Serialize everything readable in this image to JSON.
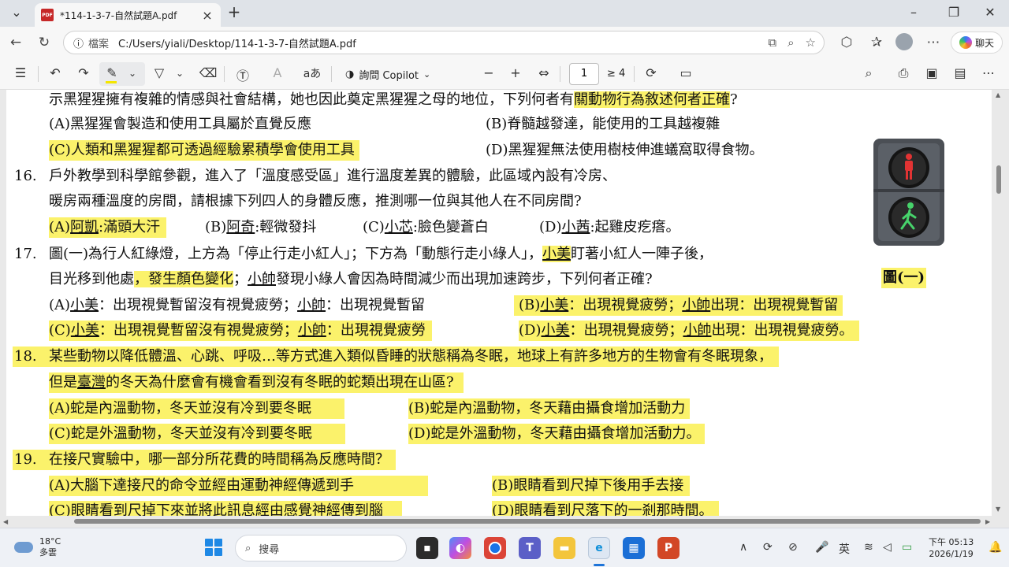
{
  "browser": {
    "tab_title": "*114-1-3-7-自然試題A.pdf",
    "pdf_badge": "PDF",
    "address_label": "檔案",
    "address_url": "C:/Users/yiali/Desktop/114-1-3-7-自然試題A.pdf",
    "copilot_button": "聊天"
  },
  "pdf_toolbar": {
    "ask_copilot": "詢問 Copilot",
    "current_page": "1",
    "total_pages": "≥ 4",
    "read_aloud": "aあ"
  },
  "document": {
    "q15_line1_a": "示黑猩猩擁有複雜的情感與社會結構，她也因此奠定黑猩猩之母的地位，下列何者有",
    "q15_line1_hl": "關動物行為敘述何者正確",
    "q15_line1_end": "?",
    "q15_optA": "(A)黑猩猩會製造和使用工具屬於直覺反應",
    "q15_optB": "(B)脊髓越發達，能使用的工具越複雜",
    "q15_optC": "(C)人類和黑猩猩都可透過經驗累積學會使用工具",
    "q15_optD": "(D)黑猩猩無法使用樹枝伸進蟻窩取得食物。",
    "q16_num": "16.",
    "q16_line1": "戶外教學到科學館參觀，進入了「溫度感受區」進行溫度差異的體驗，此區域內設有冷房、",
    "q16_line2": "暖房兩種溫度的房間，請根據下列四人的身體反應，推測哪一位與其他人在不同房間?",
    "q16_optA_pre": "(A)",
    "q16_optA_name": "阿凱",
    "q16_optA_text": ":滿頭大汗",
    "q16_optB_pre": "(B)",
    "q16_optB_name": "阿奇",
    "q16_optB_text": ":輕微發抖",
    "q16_optC_pre": "(C)",
    "q16_optC_name": "小芯",
    "q16_optC_text": ":臉色變蒼白",
    "q16_optD_pre": "(D)",
    "q16_optD_name": "小茜",
    "q16_optD_text": ":起雞皮疙瘩。",
    "q17_num": "17.",
    "q17_line1_a": "圖(一)為行人紅綠燈，上方為「停止行走小紅人」；下方為「動態行走小綠人」，",
    "q17_line1_name": "小美",
    "q17_line1_b": "盯著小紅人一陣子後，",
    "q17_line2_a": "目光移到他處",
    "q17_line2_hl": "，發生顏色變化",
    "q17_line2_b": "；",
    "q17_line2_name": "小帥",
    "q17_line2_c": "發現小綠人會因為時間減少而出現加速跨步，下列何者正確?",
    "q17_fig_caption": "圖(一)",
    "q17_optA_a": "(A)",
    "q17_optA_n1": "小美",
    "q17_optA_b": "：出現視覺暫留沒有視覺疲勞；",
    "q17_optA_n2": "小帥",
    "q17_optA_c": "：出現視覺暫留",
    "q17_optB_a": "(B)",
    "q17_optB_n1": "小美",
    "q17_optB_b": "：出現視覺疲勞；",
    "q17_optB_n2": "小帥",
    "q17_optB_c": "出現：出現視覺暫留",
    "q17_optC_a": "(C)",
    "q17_optC_n1": "小美",
    "q17_optC_b": "：出現視覺暫留沒有視覺疲勞；",
    "q17_optC_n2": "小帥",
    "q17_optC_c": "：出現視覺疲勞",
    "q17_optD_a": "(D)",
    "q17_optD_n1": "小美",
    "q17_optD_b": "：出現視覺疲勞；",
    "q17_optD_n2": "小帥",
    "q17_optD_c": "出現：出現視覺疲勞。",
    "q18_num": "18.",
    "q18_line1": "某些動物以降低體溫、心跳、呼吸…等方式進入類似昏睡的狀態稱為冬眠，地球上有許多地方的生物會有冬眠現象，",
    "q18_line2_a": "但是",
    "q18_line2_name": "臺灣",
    "q18_line2_b": "的冬天為什麼會有機會看到沒有冬眠的蛇類出現在山區?",
    "q18_optA": "(A)蛇是內溫動物，冬天並沒有冷到要冬眠",
    "q18_optB": "(B)蛇是內溫動物，冬天藉由攝食增加活動力",
    "q18_optC": "(C)蛇是外溫動物，冬天並沒有冷到要冬眠",
    "q18_optD": "(D)蛇是外溫動物，冬天藉由攝食增加活動力。",
    "q19_num": "19.",
    "q19_line1": "在接尺實驗中，哪一部分所花費的時間稱為反應時間？",
    "q19_optA": "(A)大腦下達接尺的命令並經由運動神經傳遞到手",
    "q19_optB": "(B)眼睛看到尺掉下後用手去接",
    "q19_optC": "(C)眼睛看到尺掉下來並將此訊息經由感覺神經傳到腦",
    "q19_optD": "(D)眼睛看到尺落下的一剎那時間。"
  },
  "taskbar": {
    "temperature": "18°C",
    "weather": "多雲",
    "search_placeholder": "搜尋",
    "ime": "英",
    "time": "下午 05:13",
    "date": "2026/1/19"
  },
  "colors": {
    "highlight": "#fbf26b",
    "pdf_red": "#c62828",
    "accent": "#1e74d8"
  }
}
